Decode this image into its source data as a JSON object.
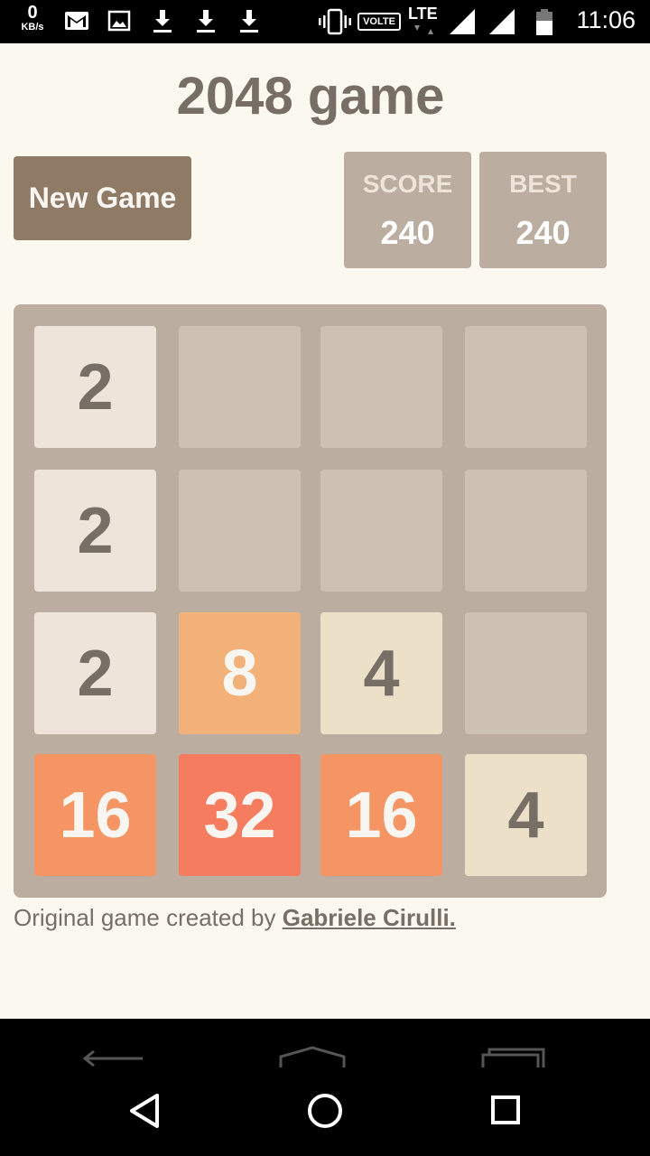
{
  "status_bar": {
    "speed_value": "0",
    "speed_unit": "KB/s",
    "network": "LTE",
    "volte": "VOLTE",
    "time": "11:06",
    "icons": [
      "gmail-icon",
      "image-icon",
      "download-icon",
      "download-icon",
      "download-icon",
      "vibrate-icon",
      "signal-icon",
      "signal-icon",
      "battery-icon"
    ]
  },
  "game": {
    "title": "2048 game",
    "new_game_label": "New Game",
    "score_label": "SCORE",
    "score_value": "240",
    "best_label": "BEST",
    "best_value": "240",
    "grid": [
      [
        2,
        0,
        0,
        0
      ],
      [
        2,
        0,
        0,
        0
      ],
      [
        2,
        8,
        4,
        0
      ],
      [
        16,
        32,
        16,
        4
      ]
    ],
    "tile_colors": {
      "2": {
        "bg": "#eee4da",
        "fg": "#776e65"
      },
      "4": {
        "bg": "#ede0c8",
        "fg": "#776e65"
      },
      "8": {
        "bg": "#f2b179",
        "fg": "#f9f6f2"
      },
      "16": {
        "bg": "#f59563",
        "fg": "#f9f6f2"
      },
      "32": {
        "bg": "#f67c5f",
        "fg": "#f9f6f2"
      }
    }
  },
  "footer": {
    "credit_prefix": "Original game created by ",
    "credit_author": "Gabriele Cirulli."
  },
  "nav_bar": {
    "icons": [
      "back-icon",
      "home-icon",
      "recents-icon"
    ]
  }
}
